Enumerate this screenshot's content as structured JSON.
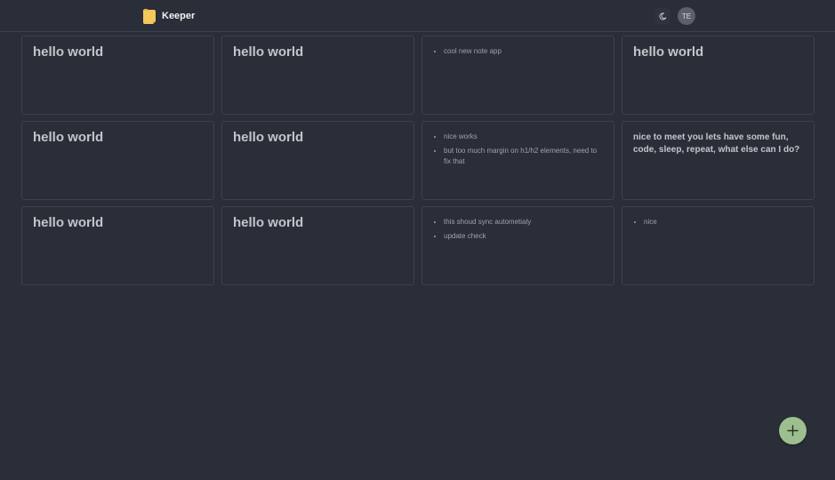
{
  "app": {
    "title": "Keeper",
    "logo_icon": "sticky-note-icon",
    "theme_icon": "moon-icon",
    "avatar_initials": "TE"
  },
  "colors": {
    "background": "#2a2e38",
    "card_border": "#3c414c",
    "fab": "#9dbf8f",
    "logo": "#f4c75b"
  },
  "notes": [
    {
      "heading": "hello world"
    },
    {
      "heading": "hello world"
    },
    {
      "items": [
        "cool new note app"
      ]
    },
    {
      "heading": "hello world"
    },
    {
      "heading": "hello world"
    },
    {
      "heading": "hello world"
    },
    {
      "items": [
        "nice works",
        "but too much margin on h1/h2 elements, need to fix that"
      ]
    },
    {
      "paragraph": "nice to meet you lets have some fun, code, sleep, repeat, what else can I do?"
    },
    {
      "heading": "hello world"
    },
    {
      "heading": "hello world"
    },
    {
      "items": [
        "this shoud sync autometialy",
        "update check"
      ]
    },
    {
      "items": [
        "nice"
      ]
    }
  ],
  "fab": {
    "icon": "plus-icon"
  }
}
